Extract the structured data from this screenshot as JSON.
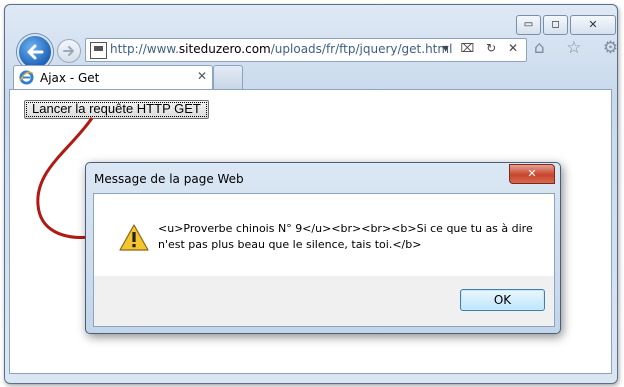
{
  "window": {
    "minimize_glyph": "▭",
    "maximize_glyph": "◻",
    "close_glyph": "✕"
  },
  "navigation": {
    "url_prefix": "http://www.",
    "url_domain": "siteduzero.com",
    "url_path": "/uploads/fr/ftp/jquery/get.html",
    "address_icons": "▾ ⌧ ↻ ✕",
    "toolbar_icons": "⌂ ☆ ⚙"
  },
  "tab": {
    "title": "Ajax - Get",
    "close_glyph": "✕"
  },
  "page": {
    "button_label": "Lancer la requête HTTP GET"
  },
  "dialog": {
    "title": "Message de la page Web",
    "close_glyph": "✕",
    "message": "<u>Proverbe chinois N° 9</u><br><br><b>Si ce que tu as à dire\nn'est pas plus beau que le silence, tais toi.</b>",
    "ok_label": "OK"
  },
  "colors": {
    "arrow": "#b01a12",
    "accent": "#1d63b8"
  }
}
